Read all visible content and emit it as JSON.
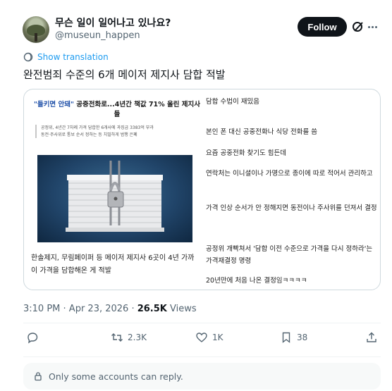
{
  "author": {
    "display_name": "무슨 일이 일어나고 있나요?",
    "handle": "@museun_happen"
  },
  "header": {
    "follow_label": "Follow"
  },
  "post": {
    "show_translation": "Show translation",
    "text": "완전범죄 수준의 6개 메이저 제지사 담합 적발"
  },
  "card": {
    "headline_quote": "\"들키면 안돼\"",
    "headline_rest": " 공중전화로...4년간 책값 71% 올린 제지사들",
    "blurb_1": "공정위, 4년간 7차례 가격 담합한 6개사에 과징금 3383억 부과",
    "blurb_2": "동전·주사위로 통보 순서 정하는 등 치밀하게 범행 은폐",
    "caption": "한솔제지, 무림페이퍼 등 메이저 제지사 6곳이 4년 가까이 가격을 담합해온 게 적발",
    "list": [
      "담합 수법이 재밌음",
      "본인 폰 대신 공중전화나 식당 전화를 씀",
      "요즘 공중전화 찾기도 힘든데",
      "연락처는 이니셜이나 가명으로 종이에 따로 적어서 관리하고",
      "가격 인상 순서가 안 정해지면 동전이나 주사위를 던져서 결정",
      "공정위 개빡쳐서 '담합 이전 수준으로 가격을 다시 정하라'는 가격재결정 명령",
      "20년만에 처음 나온 결정임ㅋㅋㅋㅋ"
    ]
  },
  "meta": {
    "time": "3:10 PM",
    "separator": " · ",
    "date": "Apr 23, 2026",
    "views_count": "26.5K",
    "views_label": " Views"
  },
  "actions": {
    "reply_icon": "reply-icon",
    "repost_count": "2.3K",
    "like_count": "1K",
    "bookmark_count": "38",
    "share_icon": "share-icon"
  },
  "reply_restriction": {
    "text": "Only some accounts can reply."
  },
  "colors": {
    "accent": "#1d9bf0",
    "text_primary": "#0f1419",
    "text_secondary": "#536471",
    "follow_bg": "#0f1419"
  }
}
